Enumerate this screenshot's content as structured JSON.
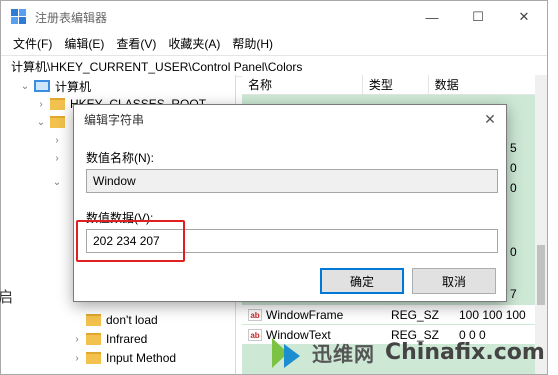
{
  "window": {
    "title": "注册表编辑器",
    "controls": {
      "minimize": "—",
      "maximize": "☐",
      "close": "✕"
    }
  },
  "menubar": [
    "文件(F)",
    "编辑(E)",
    "查看(V)",
    "收藏夹(A)",
    "帮助(H)"
  ],
  "address": "计算机\\HKEY_CURRENT_USER\\Control Panel\\Colors",
  "tree": {
    "root": "计算机",
    "items": [
      "HKEY_CLASSES_ROOT",
      "don't load",
      "Infrared",
      "Input Method"
    ]
  },
  "list": {
    "columns": {
      "name": "名称",
      "type": "类型",
      "data": "数据"
    },
    "rows": [
      {
        "name": "WindowFrame",
        "type": "REG_SZ",
        "data": "100 100 100"
      },
      {
        "name": "WindowText",
        "type": "REG_SZ",
        "data": "0 0 0"
      }
    ],
    "peek_values": [
      "5",
      "0",
      "0",
      "0",
      "7"
    ]
  },
  "dialog": {
    "title": "编辑字符串",
    "close": "✕",
    "name_label": "数值名称(N):",
    "name_value": "Window",
    "data_label": "数值数据(V):",
    "data_value": "202 234 207",
    "ok": "确定",
    "cancel": "取消"
  },
  "watermark": {
    "cn": "迅维网",
    "en": "Chinafix.com"
  },
  "colors": {
    "highlight": "#e02020",
    "list_bg": "#cde8d5",
    "accent": "#0078d7"
  }
}
